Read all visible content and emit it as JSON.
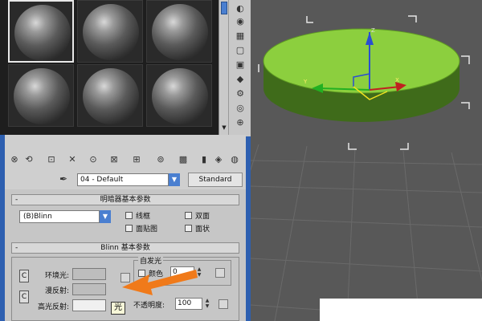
{
  "material_editor": {
    "slots_count": 6,
    "active_slot_index": 0,
    "material_name": "04 - Default",
    "material_type_button": "Standard",
    "shader_rollout": {
      "title": "明暗器基本参数",
      "toggle": "-",
      "shader": "(B)Blinn",
      "options": [
        "线框",
        "双面",
        "面贴图",
        "面状"
      ]
    },
    "blinn_rollout": {
      "title": "Blinn 基本参数",
      "toggle": "-",
      "ambient_label": "环境光:",
      "diffuse_label": "漫反射:",
      "specular_label": "高光反射:",
      "self_illum_title": "自发光",
      "color_label": "颜色",
      "color_value": "0",
      "opacity_label": "不透明度:",
      "opacity_value": "100",
      "lock_label": "C"
    },
    "tooltip": "光"
  },
  "colors": {
    "panel_bg": "#c6c6c6",
    "blue_border": "#2d5fb0",
    "viewport_bg": "#585858",
    "disc_top": "#8ccf3e",
    "disc_side": "#3f6b1a",
    "arrow_orange": "#f07a1a"
  },
  "icons": [
    "eyedropper-icon",
    "put-to-scene-icon",
    "assign-material-icon",
    "reset-icon",
    "copy-icon",
    "unique-icon",
    "put-to-library-icon",
    "material-id-icon",
    "show-map-icon",
    "show-end-result-icon",
    "go-parent-icon",
    "go-sibling-icon"
  ]
}
